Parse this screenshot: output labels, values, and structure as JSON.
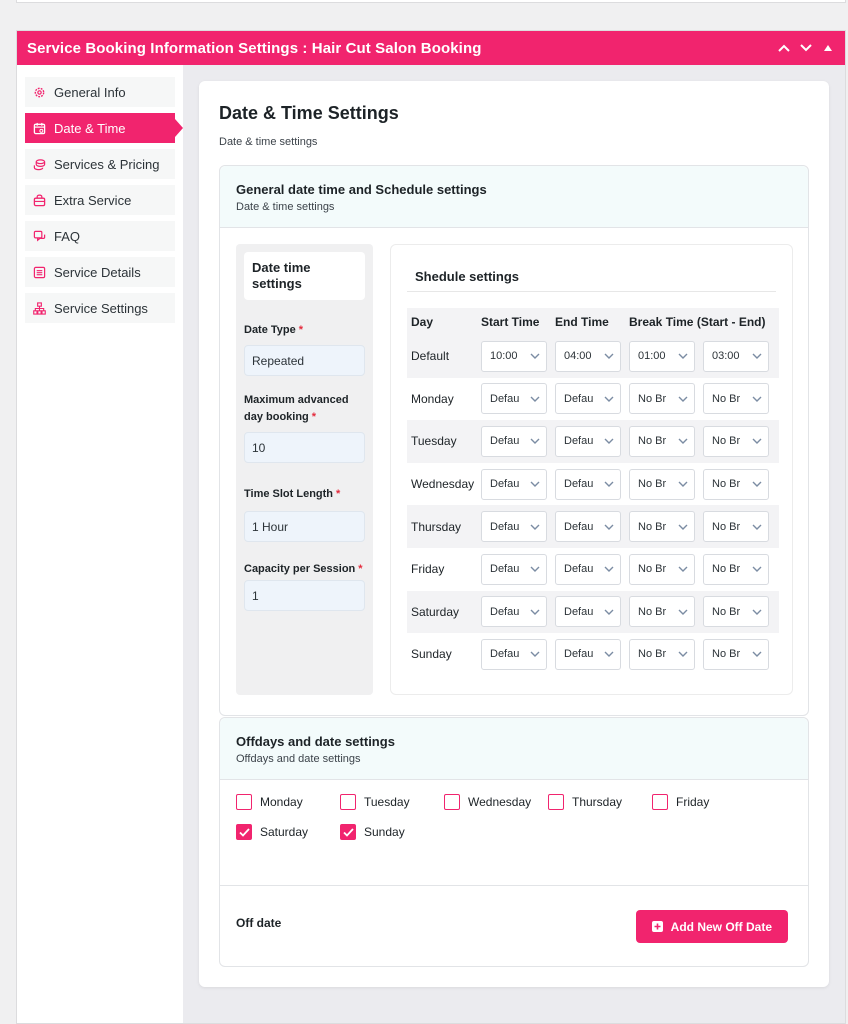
{
  "panel": {
    "title": "Service Booking Information Settings : Hair Cut Salon Booking"
  },
  "sidebar": {
    "items": [
      {
        "label": "General Info",
        "icon": "gear-icon"
      },
      {
        "label": "Date & Time",
        "icon": "calendar-icon"
      },
      {
        "label": "Services & Pricing",
        "icon": "coins-icon"
      },
      {
        "label": "Extra Service",
        "icon": "bag-icon"
      },
      {
        "label": "FAQ",
        "icon": "faq-icon"
      },
      {
        "label": "Service Details",
        "icon": "list-icon"
      },
      {
        "label": "Service Settings",
        "icon": "sitemap-icon"
      }
    ]
  },
  "main": {
    "title": "Date & Time Settings",
    "subtitle": "Date & time settings",
    "general": {
      "title": "General date time and Schedule settings",
      "subtitle": "Date & time settings",
      "left": {
        "title": "Date time settings",
        "date_type_label": "Date Type",
        "date_type_value": "Repeated",
        "max_adv_label": "Maximum advanced day booking",
        "max_adv_value": "10",
        "slot_label": "Time Slot Length",
        "slot_value": "1 Hour",
        "capacity_label": "Capacity per Session",
        "capacity_value": "1",
        "required_mark": "*"
      },
      "schedule": {
        "title": "Shedule settings",
        "headers": [
          "Day",
          "Start Time",
          "End Time",
          "Break Time (Start - End)"
        ],
        "rows": [
          {
            "day": "Default",
            "start": "10:00",
            "end": "04:00",
            "b1": "01:00",
            "b2": "03:00"
          },
          {
            "day": "Monday",
            "start": "Defau",
            "end": "Defau",
            "b1": "No Br",
            "b2": "No Br"
          },
          {
            "day": "Tuesday",
            "start": "Defau",
            "end": "Defau",
            "b1": "No Br",
            "b2": "No Br"
          },
          {
            "day": "Wednesday",
            "start": "Defau",
            "end": "Defau",
            "b1": "No Br",
            "b2": "No Br"
          },
          {
            "day": "Thursday",
            "start": "Defau",
            "end": "Defau",
            "b1": "No Br",
            "b2": "No Br"
          },
          {
            "day": "Friday",
            "start": "Defau",
            "end": "Defau",
            "b1": "No Br",
            "b2": "No Br"
          },
          {
            "day": "Saturday",
            "start": "Defau",
            "end": "Defau",
            "b1": "No Br",
            "b2": "No Br"
          },
          {
            "day": "Sunday",
            "start": "Defau",
            "end": "Defau",
            "b1": "No Br",
            "b2": "No Br"
          }
        ]
      }
    },
    "offdays": {
      "title": "Offdays and date settings",
      "subtitle": "Offdays and date settings",
      "days": [
        {
          "label": "Monday",
          "checked": false
        },
        {
          "label": "Tuesday",
          "checked": false
        },
        {
          "label": "Wednesday",
          "checked": false
        },
        {
          "label": "Thursday",
          "checked": false
        },
        {
          "label": "Friday",
          "checked": false
        },
        {
          "label": "Saturday",
          "checked": true
        },
        {
          "label": "Sunday",
          "checked": true
        }
      ],
      "off_date_label": "Off date",
      "add_button": "Add New Off Date"
    }
  },
  "colors": {
    "accent": "#f1246e"
  }
}
